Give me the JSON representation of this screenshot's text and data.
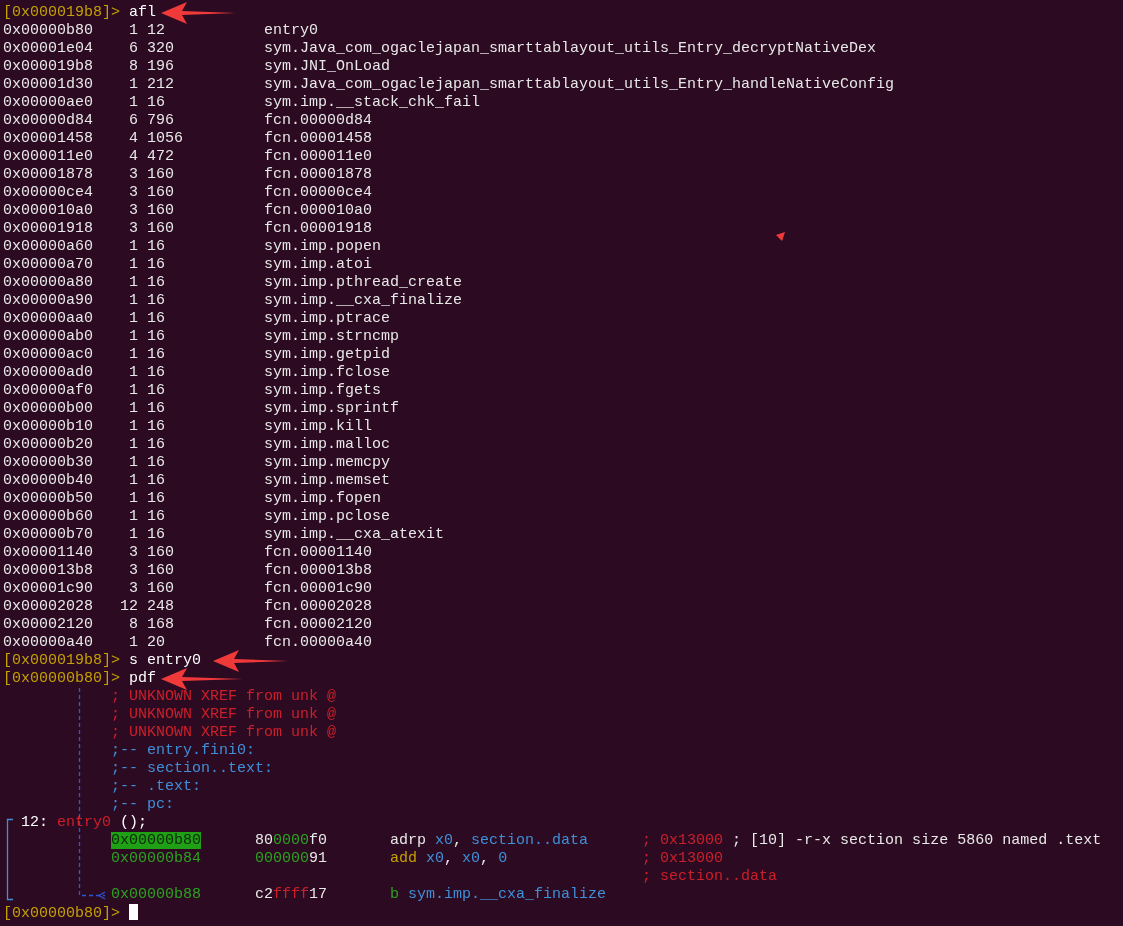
{
  "afl_prompt": {
    "prompt": "[0x000019b8]>",
    "command": "afl"
  },
  "functions": [
    {
      "address": "0x00000b80",
      "blocks": "1",
      "size": "12",
      "name": "entry0"
    },
    {
      "address": "0x00001e04",
      "blocks": "6",
      "size": "320",
      "name": "sym.Java_com_ogaclejapan_smarttablayout_utils_Entry_decryptNativeDex"
    },
    {
      "address": "0x000019b8",
      "blocks": "8",
      "size": "196",
      "name": "sym.JNI_OnLoad"
    },
    {
      "address": "0x00001d30",
      "blocks": "1",
      "size": "212",
      "name": "sym.Java_com_ogaclejapan_smarttablayout_utils_Entry_handleNativeConfig"
    },
    {
      "address": "0x00000ae0",
      "blocks": "1",
      "size": "16",
      "name": "sym.imp.__stack_chk_fail"
    },
    {
      "address": "0x00000d84",
      "blocks": "6",
      "size": "796",
      "name": "fcn.00000d84"
    },
    {
      "address": "0x00001458",
      "blocks": "4",
      "size": "1056",
      "name": "fcn.00001458"
    },
    {
      "address": "0x000011e0",
      "blocks": "4",
      "size": "472",
      "name": "fcn.000011e0"
    },
    {
      "address": "0x00001878",
      "blocks": "3",
      "size": "160",
      "name": "fcn.00001878"
    },
    {
      "address": "0x00000ce4",
      "blocks": "3",
      "size": "160",
      "name": "fcn.00000ce4"
    },
    {
      "address": "0x000010a0",
      "blocks": "3",
      "size": "160",
      "name": "fcn.000010a0"
    },
    {
      "address": "0x00001918",
      "blocks": "3",
      "size": "160",
      "name": "fcn.00001918"
    },
    {
      "address": "0x00000a60",
      "blocks": "1",
      "size": "16",
      "name": "sym.imp.popen"
    },
    {
      "address": "0x00000a70",
      "blocks": "1",
      "size": "16",
      "name": "sym.imp.atoi"
    },
    {
      "address": "0x00000a80",
      "blocks": "1",
      "size": "16",
      "name": "sym.imp.pthread_create"
    },
    {
      "address": "0x00000a90",
      "blocks": "1",
      "size": "16",
      "name": "sym.imp.__cxa_finalize"
    },
    {
      "address": "0x00000aa0",
      "blocks": "1",
      "size": "16",
      "name": "sym.imp.ptrace"
    },
    {
      "address": "0x00000ab0",
      "blocks": "1",
      "size": "16",
      "name": "sym.imp.strncmp"
    },
    {
      "address": "0x00000ac0",
      "blocks": "1",
      "size": "16",
      "name": "sym.imp.getpid"
    },
    {
      "address": "0x00000ad0",
      "blocks": "1",
      "size": "16",
      "name": "sym.imp.fclose"
    },
    {
      "address": "0x00000af0",
      "blocks": "1",
      "size": "16",
      "name": "sym.imp.fgets"
    },
    {
      "address": "0x00000b00",
      "blocks": "1",
      "size": "16",
      "name": "sym.imp.sprintf"
    },
    {
      "address": "0x00000b10",
      "blocks": "1",
      "size": "16",
      "name": "sym.imp.kill"
    },
    {
      "address": "0x00000b20",
      "blocks": "1",
      "size": "16",
      "name": "sym.imp.malloc"
    },
    {
      "address": "0x00000b30",
      "blocks": "1",
      "size": "16",
      "name": "sym.imp.memcpy"
    },
    {
      "address": "0x00000b40",
      "blocks": "1",
      "size": "16",
      "name": "sym.imp.memset"
    },
    {
      "address": "0x00000b50",
      "blocks": "1",
      "size": "16",
      "name": "sym.imp.fopen"
    },
    {
      "address": "0x00000b60",
      "blocks": "1",
      "size": "16",
      "name": "sym.imp.pclose"
    },
    {
      "address": "0x00000b70",
      "blocks": "1",
      "size": "16",
      "name": "sym.imp.__cxa_atexit"
    },
    {
      "address": "0x00001140",
      "blocks": "3",
      "size": "160",
      "name": "fcn.00001140"
    },
    {
      "address": "0x000013b8",
      "blocks": "3",
      "size": "160",
      "name": "fcn.000013b8"
    },
    {
      "address": "0x00001c90",
      "blocks": "3",
      "size": "160",
      "name": "fcn.00001c90"
    },
    {
      "address": "0x00002028",
      "blocks": "12",
      "size": "248",
      "name": "fcn.00002028"
    },
    {
      "address": "0x00002120",
      "blocks": "8",
      "size": "168",
      "name": "fcn.00002120"
    },
    {
      "address": "0x00000a40",
      "blocks": "1",
      "size": "20",
      "name": "fcn.00000a40"
    }
  ],
  "seek_prompt": {
    "prompt": "[0x000019b8]>",
    "command": "s entry0"
  },
  "pdf_prompt": {
    "prompt": "[0x00000b80]>",
    "command": "pdf"
  },
  "disassembly": {
    "xrefs": [
      "; UNKNOWN XREF from unk @",
      "; UNKNOWN XREF from unk @",
      "; UNKNOWN XREF from unk @"
    ],
    "labels": [
      ";-- entry.fini0:",
      ";-- section..text:",
      ";-- .text:",
      ";-- pc:"
    ],
    "function_header": {
      "size": "12:",
      "name": "entry0",
      "signature": "();"
    },
    "instructions": [
      {
        "address": "0x00000b80",
        "highlighted": true,
        "bytes": [
          {
            "text": "80",
            "color": "#e8e8e8"
          },
          {
            "text": "0000",
            "color": "#2aa21e"
          },
          {
            "text": "f0",
            "color": "#e8e8e8"
          }
        ],
        "code": [
          {
            "text": "adrp",
            "color": "#e8e8e8"
          },
          {
            "text": " x0",
            "color": "#3f8fd8"
          },
          {
            "text": ", ",
            "color": "#e8e8e8"
          },
          {
            "text": "section..data",
            "color": "#3f8fd8"
          }
        ],
        "comments": [
          [
            {
              "text": "; 0x13000",
              "color": "#cc1f2a"
            },
            {
              "text": " ; [10] -r-x section size 5860 named .text",
              "color": "#e8e8e8"
            }
          ]
        ]
      },
      {
        "address": "0x00000b84",
        "highlighted": false,
        "bytes": [
          {
            "text": "000000",
            "color": "#2aa21e"
          },
          {
            "text": "91",
            "color": "#e8e8e8"
          }
        ],
        "code": [
          {
            "text": "add",
            "color": "#c4a000"
          },
          {
            "text": " x0",
            "color": "#3f8fd8"
          },
          {
            "text": ", ",
            "color": "#e8e8e8"
          },
          {
            "text": "x0",
            "color": "#3f8fd8"
          },
          {
            "text": ", ",
            "color": "#e8e8e8"
          },
          {
            "text": "0",
            "color": "#3f8fd8"
          }
        ],
        "comments": [
          [
            {
              "text": "; 0x13000",
              "color": "#cc1f2a"
            }
          ],
          [
            {
              "text": "; section..data",
              "color": "#cc1f2a"
            }
          ]
        ]
      },
      {
        "address": "0x00000b88",
        "highlighted": false,
        "bytes": [
          {
            "text": "c2",
            "color": "#e8e8e8"
          },
          {
            "text": "ffff",
            "color": "#cc1f2a"
          },
          {
            "text": "17",
            "color": "#e8e8e8"
          }
        ],
        "code": [
          {
            "text": "b",
            "color": "#2aa21e"
          },
          {
            "text": " sym.imp.__cxa_finalize",
            "color": "#3f8fd8"
          }
        ]
      }
    ]
  },
  "final_prompt": {
    "prompt": "[0x00000b80]>"
  }
}
